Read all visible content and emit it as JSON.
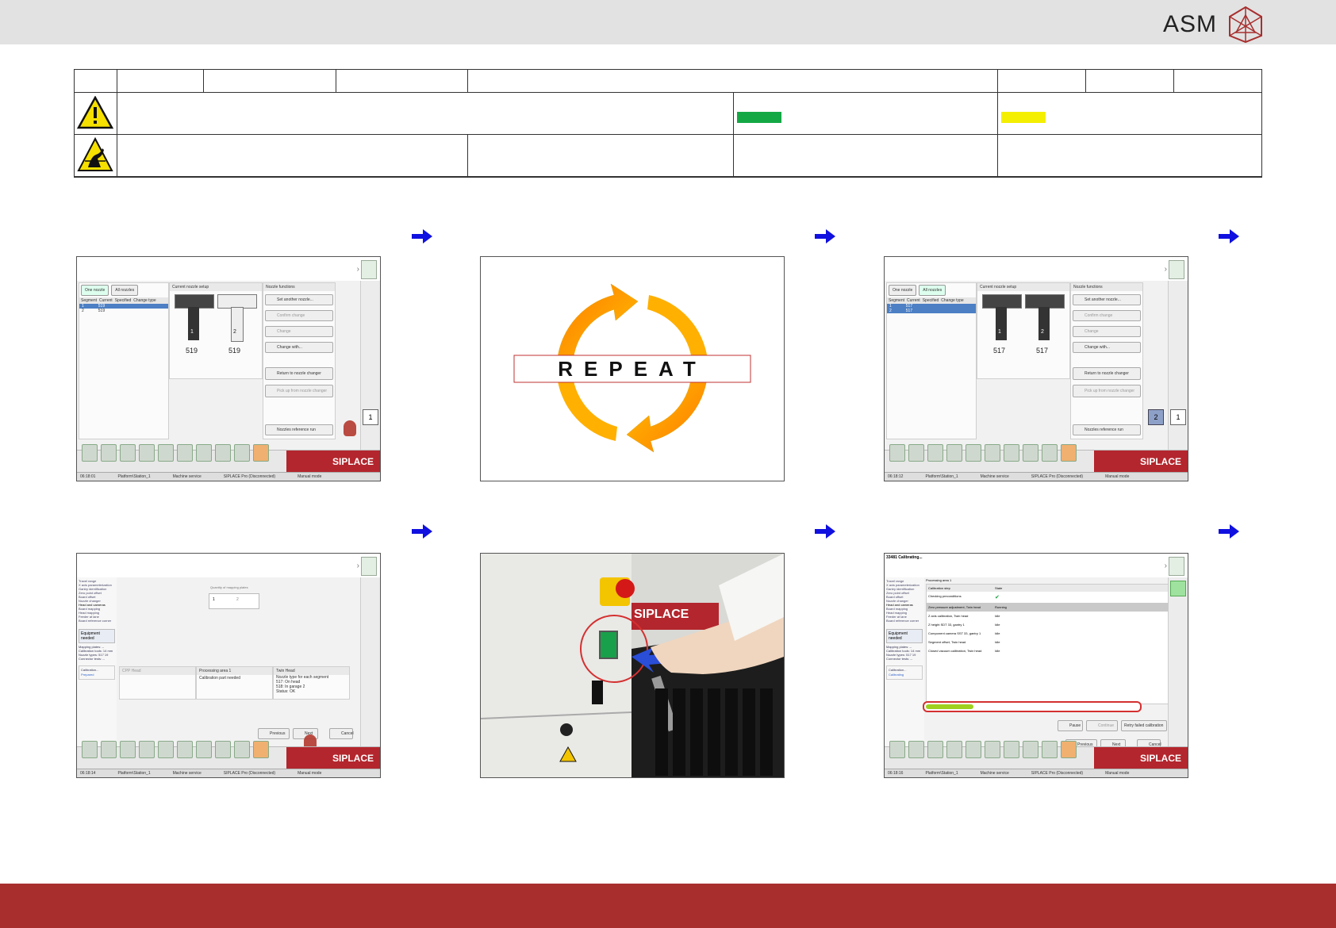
{
  "brand": {
    "name": "ASM",
    "logo_icon": "asm-tetrahedron-logo",
    "accent": "#a82e2e"
  },
  "header_table": {
    "warning_icon": "warning-triangle-icon",
    "esd_icon": "esd-warning-icon",
    "green_swatch": "#14a845",
    "yellow_swatch": "#f4ee00"
  },
  "arrows": {
    "icon": "blue-right-arrow-icon",
    "color": "#1010e0"
  },
  "steps": [
    {
      "type": "screen",
      "screen": {
        "tabs": [
          "One nozzle",
          "All nozzles"
        ],
        "table_headers": [
          "Segment",
          "Current",
          "Specified",
          "Change type"
        ],
        "rows": [
          [
            "1",
            "519"
          ],
          [
            "2",
            "519"
          ]
        ],
        "current_setup_title": "Current nozzle setup",
        "nozzle_values": [
          "519",
          "519"
        ],
        "segment_numbers": [
          "1",
          "2"
        ],
        "functions_title": "Nozzle functions",
        "buttons": [
          "Set another nozzle...",
          "Confirm change",
          "Change",
          "Change with...",
          "Return to\nnozzle changer",
          "Pick up\nfrom nozzle changer",
          "Nozzles reference run"
        ],
        "gantry_labels": [
          "1"
        ],
        "status": [
          "06:18:01",
          "Platform\\Station_1",
          "Machine service",
          "SIPLACE Pro (Disconnected)",
          "Manual mode"
        ],
        "brand": "SIPLACE"
      }
    },
    {
      "type": "repeat",
      "text": "REPEAT"
    },
    {
      "type": "screen",
      "screen": {
        "tabs": [
          "One nozzle",
          "All nozzles"
        ],
        "table_headers": [
          "Segment",
          "Current",
          "Specified",
          "Change type"
        ],
        "rows": [
          [
            "1",
            "517"
          ],
          [
            "2",
            "517"
          ]
        ],
        "current_setup_title": "Current nozzle setup",
        "nozzle_values": [
          "517",
          "517"
        ],
        "segment_numbers": [
          "1",
          "2"
        ],
        "functions_title": "Nozzle functions",
        "buttons": [
          "Set another nozzle...",
          "Confirm change",
          "Change",
          "Change with...",
          "Return to\nnozzle changer",
          "Pick up\nfrom nozzle changer",
          "Nozzles reference run"
        ],
        "gantry_labels": [
          "2",
          "1"
        ],
        "status": [
          "06:18:12",
          "Platform\\Station_1",
          "Machine service",
          "SIPLACE Pro (Disconnected)",
          "Manual mode"
        ],
        "brand": "SIPLACE"
      }
    },
    {
      "type": "calib_setup",
      "screen": {
        "sidebar": [
          "Travel range",
          "X axis parameterization",
          "Gantry identification",
          "Zero point offset",
          "Board offset",
          "Nozzle changer",
          "Head and cameras",
          "Board mapping",
          "Head mapping",
          "Feeder at lane",
          "Board reference corner"
        ],
        "equipment_title": "Equipment needed",
        "equipment": [
          "Mapping plates: --",
          "Calibration tools: 14 mm",
          "Nozzle types: 517 19",
          "Connector tests: --"
        ],
        "calib_list": [
          "Calibration...",
          "Prepared"
        ],
        "mapping_title": "Quantity of mapping plates",
        "mapping_options": [
          "1",
          "2"
        ],
        "cols": [
          "CPP Head",
          "Processing area 1",
          "Twin Head"
        ],
        "col_text": [
          "Calibration part needed",
          "Nozzle type for each segment",
          "517: On head",
          "518: In garage 2",
          "Status: OK"
        ],
        "nav": [
          "Previous",
          "Next",
          "Cancel"
        ],
        "status": [
          "06:18:14",
          "Platform\\Station_1",
          "Machine service",
          "SIPLACE Pro (Disconnected)",
          "Manual mode"
        ],
        "brand": "SIPLACE"
      }
    },
    {
      "type": "photo",
      "label": "SIPLACE"
    },
    {
      "type": "calibrating",
      "screen": {
        "title": "33481 Calibrating...",
        "area": "Processing area 1",
        "headers": [
          "Calibration step",
          "State"
        ],
        "steps": [
          [
            "Checking preconditions",
            "✔"
          ],
          [
            "Zero pressure adjustment, Twin head",
            "Running"
          ],
          [
            "Z axis calibration, Twin head",
            "Idle"
          ],
          [
            "Z height SDT 33, gantry 1",
            "Idle"
          ],
          [
            "Component camera SST 33, gantry 1",
            "Idle"
          ],
          [
            "Segment offset, Twin head",
            "Idle"
          ],
          [
            "Closed vacuum calibration, Twin head",
            "Idle"
          ]
        ],
        "progress": 0.22,
        "controls": [
          "Pause",
          "Continue",
          "Retry failed calibration"
        ],
        "nav": [
          "Previous",
          "Next",
          "Cancel"
        ],
        "calib_list": [
          "Calibration...",
          "Calibrating"
        ],
        "status": [
          "06:18:16",
          "Platform\\Station_1",
          "Machine service",
          "SIPLACE Pro (Disconnected)",
          "Manual mode"
        ],
        "brand": "SIPLACE"
      }
    }
  ]
}
